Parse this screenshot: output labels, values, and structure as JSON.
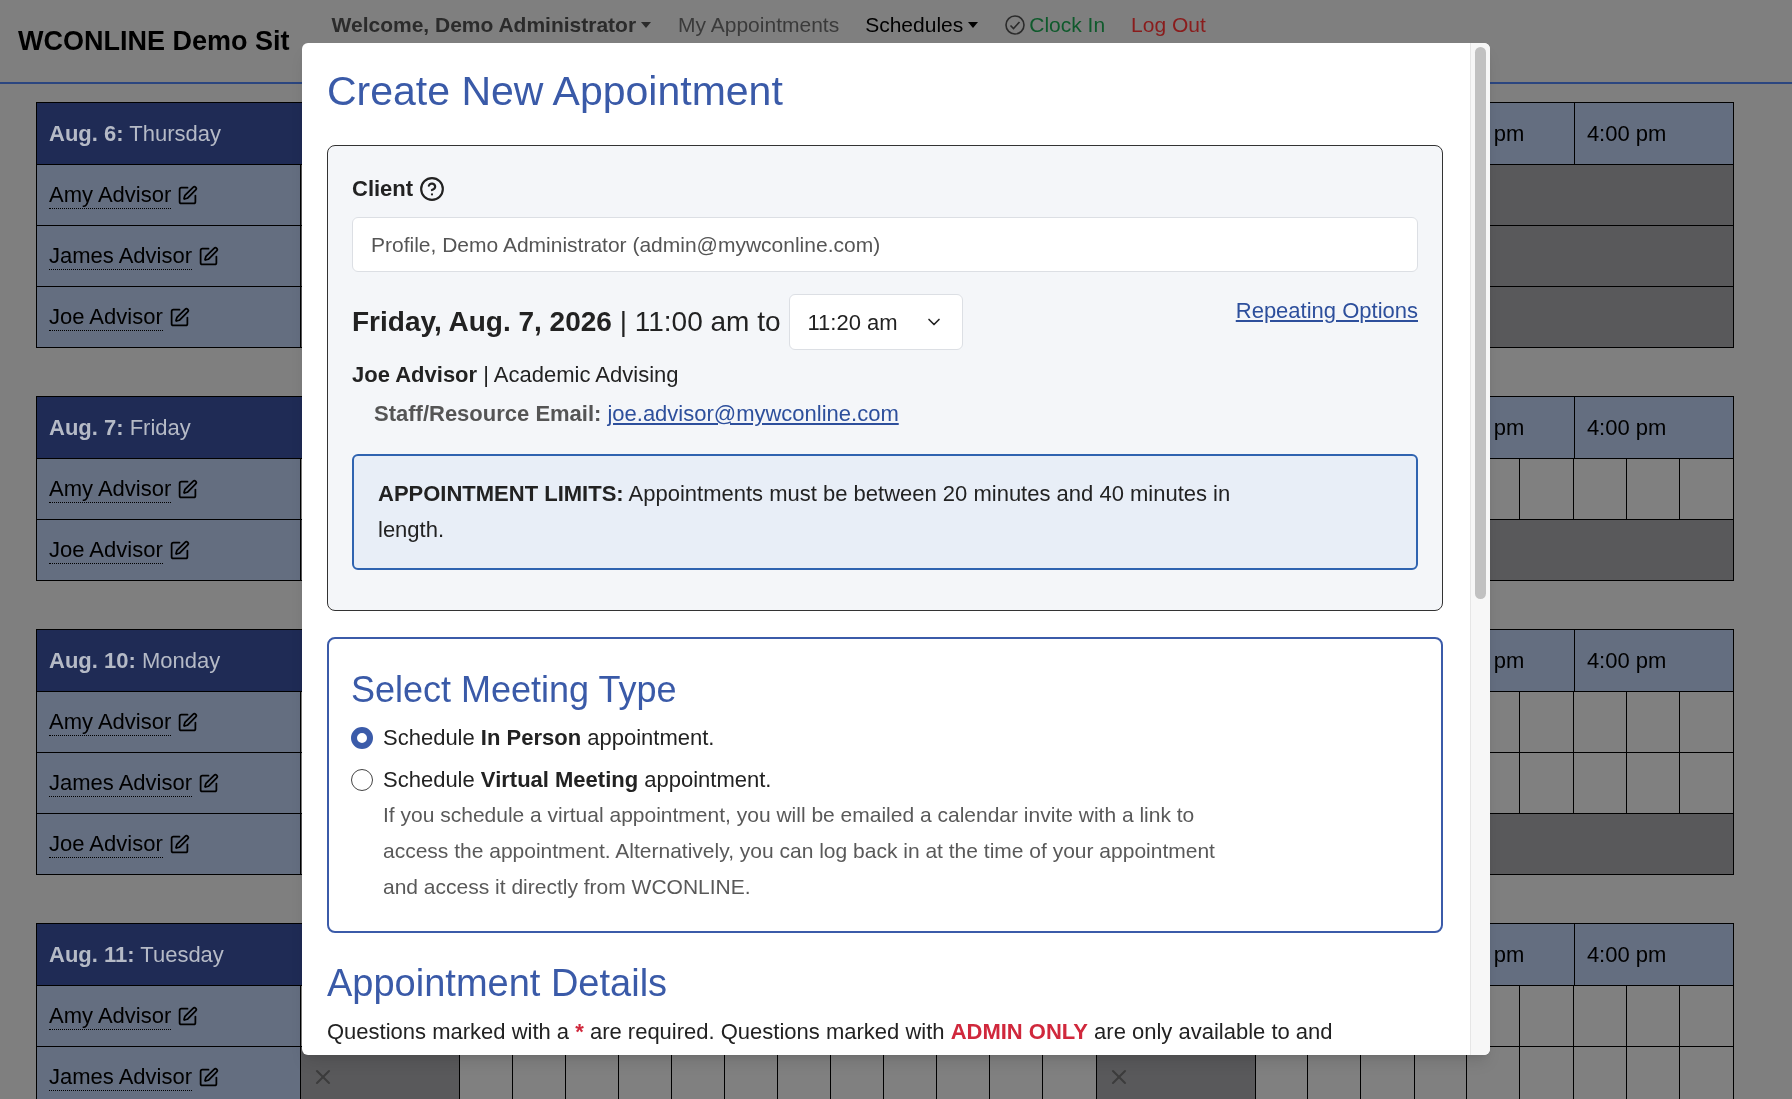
{
  "header": {
    "site_title": "WCONLINE Demo Sit",
    "nav": [
      {
        "label": "Welcome, Demo Administrator",
        "kind": "dropdown"
      },
      {
        "label": "My Appointments",
        "kind": "link"
      },
      {
        "label": "Schedules",
        "kind": "menu"
      },
      {
        "label": "Clock In",
        "kind": "clock"
      },
      {
        "label": "Log Out",
        "kind": "logout"
      }
    ]
  },
  "schedule": {
    "days": [
      {
        "date": "Aug. 6:",
        "weekday": "Thursday",
        "time_headers": [
          "pm",
          "4:00 pm"
        ],
        "rows": [
          {
            "name": "Amy Advisor",
            "kind": "unavailable"
          },
          {
            "name": "James Advisor",
            "kind": "unavailable"
          },
          {
            "name": "Joe Advisor",
            "kind": "unavailable"
          }
        ]
      },
      {
        "date": "Aug. 7:",
        "weekday": "Friday",
        "time_headers": [
          "pm",
          "4:00 pm"
        ],
        "rows": [
          {
            "name": "Amy Advisor",
            "kind": "slots",
            "hours": [
              {
                "closed": false
              },
              {
                "closed": false
              }
            ]
          },
          {
            "name": "Joe Advisor",
            "kind": "unavailable"
          }
        ]
      },
      {
        "date": "Aug. 10:",
        "weekday": "Monday",
        "time_headers": [
          "pm",
          "4:00 pm"
        ],
        "rows": [
          {
            "name": "Amy Advisor",
            "kind": "slots",
            "hours": [
              {
                "closed": false
              },
              {
                "closed": false
              }
            ]
          },
          {
            "name": "James Advisor",
            "kind": "slots",
            "hours": [
              {
                "closed": false
              },
              {
                "closed": false
              }
            ]
          },
          {
            "name": "Joe Advisor",
            "kind": "unavailable"
          }
        ]
      },
      {
        "date": "Aug. 11:",
        "weekday": "Tuesday",
        "time_headers": [
          "pm",
          "4:00 pm"
        ],
        "rows": [
          {
            "name": "Amy Advisor",
            "kind": "slots",
            "hours": [
              {
                "closed": false
              },
              {
                "closed": false
              }
            ]
          },
          {
            "name": "James Advisor",
            "kind": "slots",
            "hours": [
              {
                "closed": true
              },
              {
                "closed": false
              },
              {
                "closed": false
              },
              {
                "closed": false
              },
              {
                "closed": false
              },
              {
                "closed": true
              },
              {
                "closed": false
              },
              {
                "closed": false
              },
              {
                "closed": false
              }
            ]
          }
        ]
      }
    ]
  },
  "modal": {
    "title": "Create New Appointment",
    "client": {
      "label": "Client",
      "value": "Profile, Demo Administrator (admin@mywconline.com)"
    },
    "date_line": "**Friday, Aug. 7, 2026** | 11:00 am to",
    "end_time": "11:20 am",
    "repeating_link": "Repeating Options",
    "advisor_line": "**Joe Advisor** | Academic Advising",
    "email_label": "Staff/Resource Email:",
    "email": "joe.advisor@mywconline.com",
    "limits": "**APPOINTMENT LIMITS:** Appointments must be between 20 minutes and 40 minutes in length.",
    "meeting_type": {
      "title": "Select Meeting Type",
      "options": [
        {
          "label": "Schedule **In Person** appointment.",
          "selected": true
        },
        {
          "label": "Schedule **Virtual Meeting** appointment.",
          "selected": false,
          "description": "If you schedule a virtual appointment, you will be emailed a calendar invite with a link to access the appointment. Alternatively, you can log back in at the time of your appointment and access it directly from WCONLINE."
        }
      ]
    },
    "details": {
      "title": "Appointment Details",
      "note": [
        {
          "text": "Questions marked with a ",
          "kind": "plain"
        },
        {
          "text": "*",
          "kind": "required"
        },
        {
          "text": " are required. Questions marked with ",
          "kind": "plain"
        },
        {
          "text": "ADMIN ONLY",
          "kind": "admin"
        },
        {
          "text": " are only available to and",
          "kind": "plain"
        }
      ]
    }
  }
}
